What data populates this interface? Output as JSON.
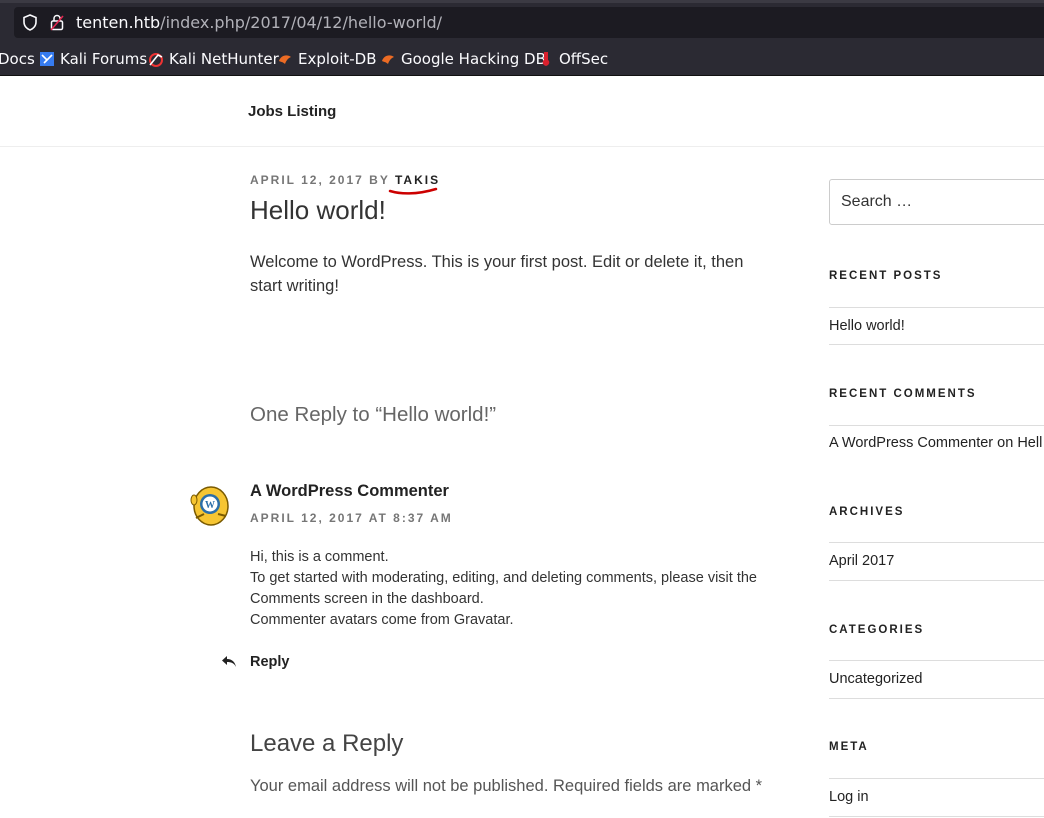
{
  "browser": {
    "url_host": "tenten.htb",
    "url_path": "/index.php/2017/04/12/hello-world/",
    "bookmarks": [
      {
        "label": "Docs",
        "icon": "none"
      },
      {
        "label": "Kali Forums",
        "icon": "kali-forums-icon"
      },
      {
        "label": "Kali NetHunter",
        "icon": "kali-nethunter-icon"
      },
      {
        "label": "Exploit-DB",
        "icon": "exploit-db-icon"
      },
      {
        "label": "Google Hacking DB",
        "icon": "google-hacking-db-icon"
      },
      {
        "label": "OffSec",
        "icon": "offsec-icon"
      }
    ]
  },
  "site": {
    "title": "Jobs Listing"
  },
  "post": {
    "date": "APRIL 12, 2017",
    "by": "BY",
    "author": "TAKIS",
    "title": "Hello world!",
    "content": "Welcome to WordPress. This is your first post. Edit or delete it, then start writing!"
  },
  "comments": {
    "title": "One Reply to “Hello world!”",
    "items": [
      {
        "author": "A WordPress Commenter",
        "date": "APRIL 12, 2017 AT 8:37 AM",
        "lines": [
          "Hi, this is a comment.",
          "To get started with moderating, editing, and deleting comments, please visit the Comments screen in the dashboard.",
          "Commenter avatars come from Gravatar."
        ],
        "reply_label": "Reply"
      }
    ]
  },
  "respond": {
    "title": "Leave a Reply",
    "note": "Your email address will not be published. Required fields are marked *"
  },
  "sidebar": {
    "search_placeholder": "Search …",
    "recent_posts": {
      "title": "RECENT POSTS",
      "items": [
        "Hello world!"
      ]
    },
    "recent_comments": {
      "title": "RECENT COMMENTS",
      "author": "A WordPress Commenter",
      "on": "on",
      "post": "Hell"
    },
    "archives": {
      "title": "ARCHIVES",
      "items": [
        "April 2017"
      ]
    },
    "categories": {
      "title": "CATEGORIES",
      "items": [
        "Uncategorized"
      ]
    },
    "meta": {
      "title": "META",
      "items": [
        "Log in"
      ]
    }
  },
  "colors": {
    "chrome_bg": "#2b2a33",
    "url_field_bg": "#1c1b22",
    "annotation_red": "#cc0000"
  }
}
